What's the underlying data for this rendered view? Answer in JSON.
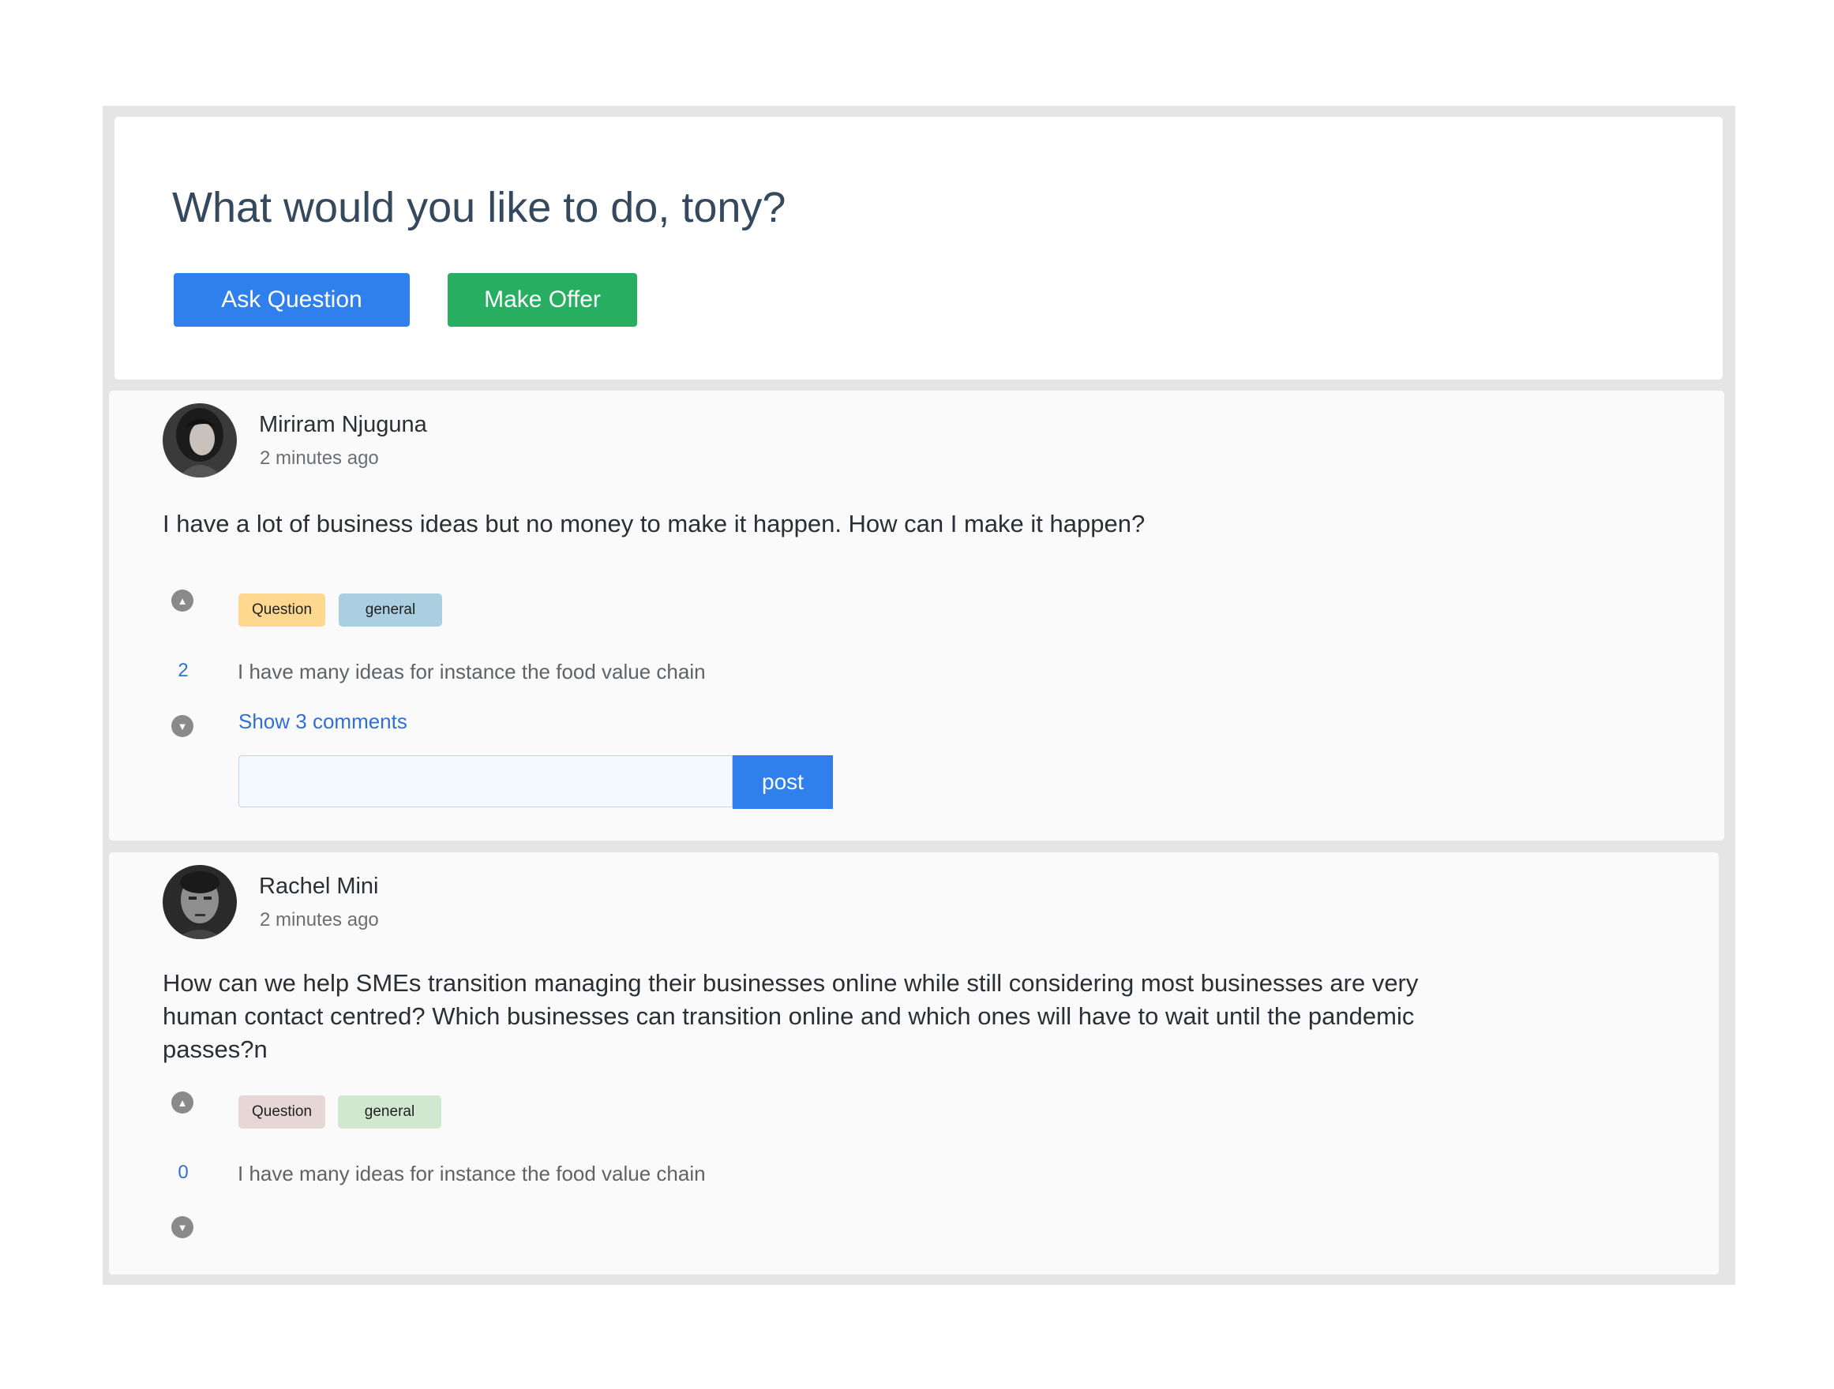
{
  "hero": {
    "title": "What would you like to do, tony?",
    "ask_label": "Ask Question",
    "offer_label": "Make  Offer"
  },
  "colors": {
    "ask": "#2f80ed",
    "offer": "#27ae60",
    "post": "#2f80ed",
    "link": "#2f6fd6"
  },
  "posts": [
    {
      "author": "Miriram  Njuguna",
      "time": "2 minutes ago",
      "text": "I have a lot of business ideas but no money to make it happen. How can I make it happen?",
      "votes": "2",
      "tags": [
        {
          "label": "Question",
          "color": "#fdd88e"
        },
        {
          "label": "general",
          "color": "#a9cfe0"
        }
      ],
      "answer": "I have many ideas for instance the food value chain",
      "show_comments": "Show 3 comments",
      "comment_placeholder": "",
      "post_label": "post"
    },
    {
      "author": "Rachel Mini",
      "time": "2 minutes ago",
      "text": "How can we help SMEs transition managing their businesses online while still considering most businesses are very human contact centred? Which businesses can transition online and which ones will have to wait until the pandemic passes?n",
      "votes": "0",
      "tags": [
        {
          "label": "Question",
          "color": "#e6d6d6"
        },
        {
          "label": "general",
          "color": "#cfe8cf"
        }
      ],
      "answer": "I have many ideas for instance the food value chain"
    }
  ]
}
